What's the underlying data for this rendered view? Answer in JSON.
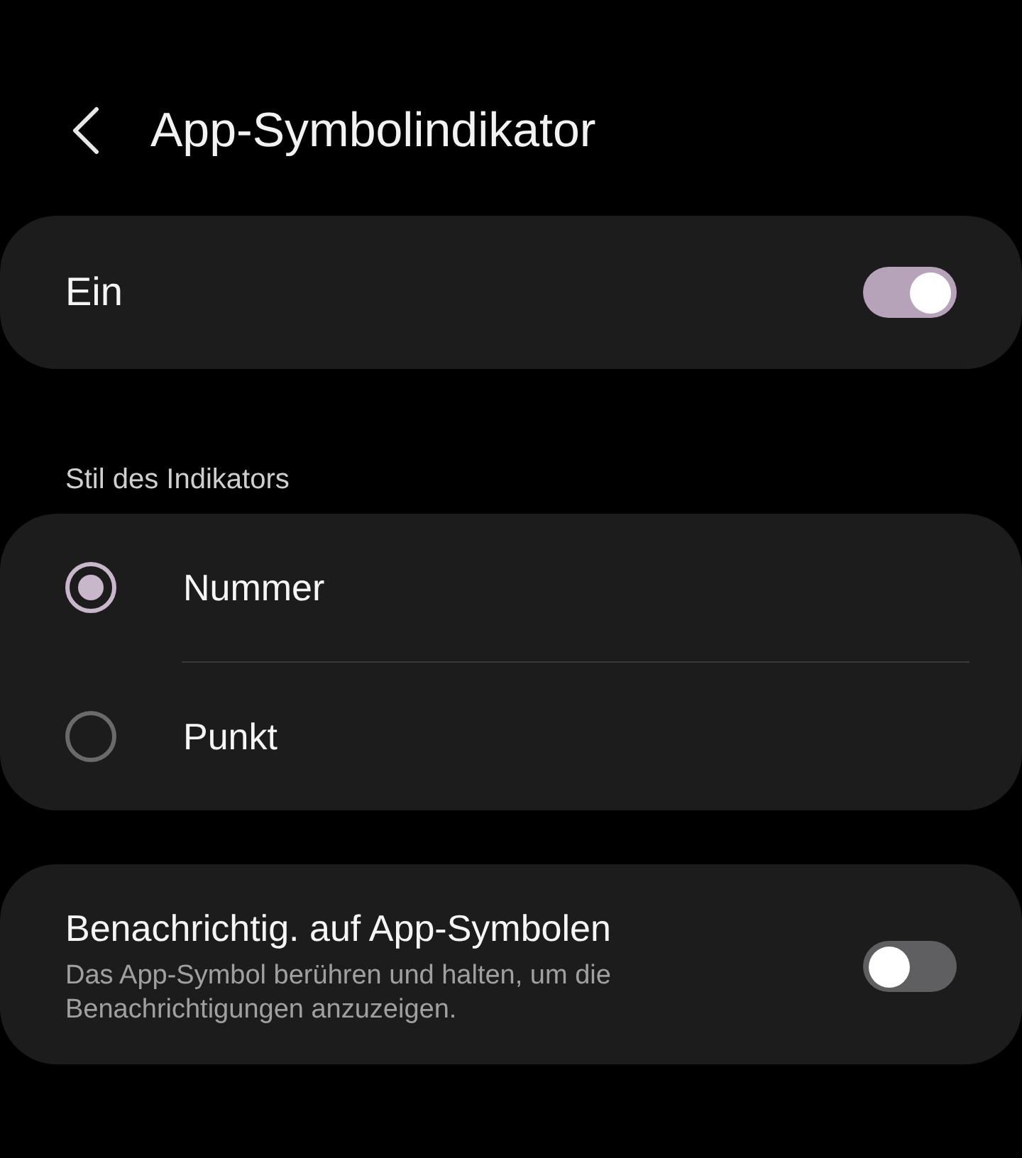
{
  "header": {
    "title": "App-Symbolindikator"
  },
  "master_switch": {
    "label": "Ein",
    "on": true
  },
  "style_section": {
    "label": "Stil des Indikators",
    "options": [
      {
        "label": "Nummer",
        "selected": true
      },
      {
        "label": "Punkt",
        "selected": false
      }
    ]
  },
  "notification_setting": {
    "title": "Benachrichtig. auf App-Symbolen",
    "description": "Das App-Symbol berühren und halten, um die Benachrichtigungen anzuzeigen.",
    "on": false
  }
}
